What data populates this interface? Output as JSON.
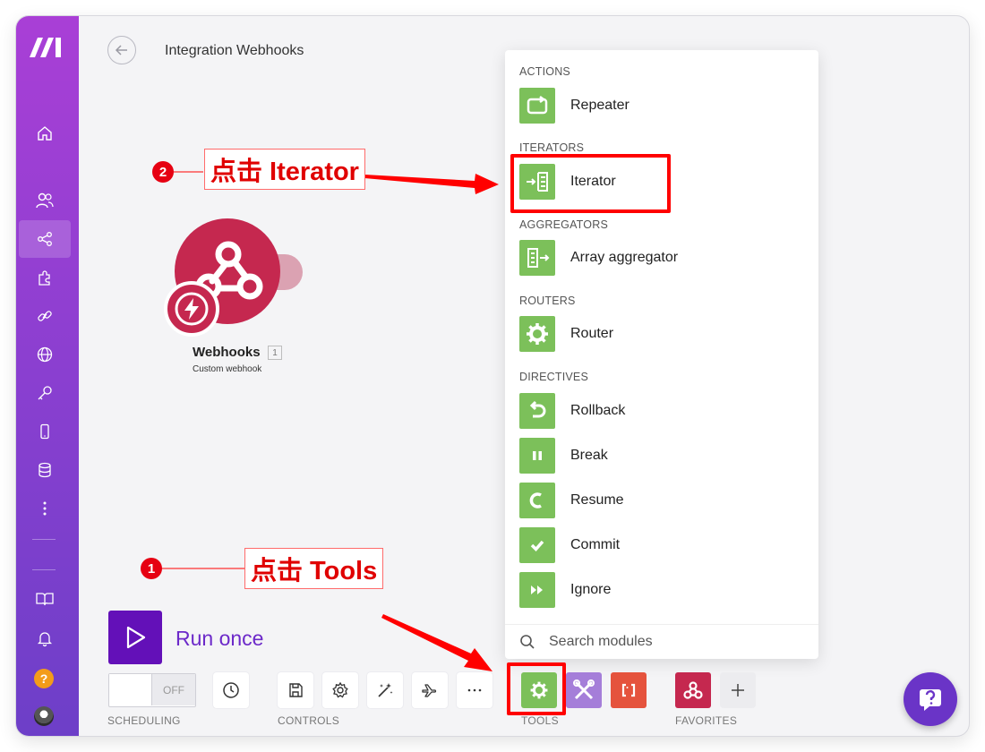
{
  "header": {
    "title": "Integration Webhooks"
  },
  "node": {
    "label": "Webhooks",
    "badge": "1",
    "subtitle": "Custom webhook",
    "color": "#c5284f"
  },
  "menu": {
    "sections": {
      "actions": "ACTIONS",
      "iterators": "ITERATORS",
      "aggregators": "AGGREGATORS",
      "routers": "ROUTERS",
      "directives": "DIRECTIVES"
    },
    "items": {
      "repeater": "Repeater",
      "iterator": "Iterator",
      "array_aggregator": "Array aggregator",
      "router": "Router",
      "rollback": "Rollback",
      "break": "Break",
      "resume": "Resume",
      "commit": "Commit",
      "ignore": "Ignore"
    },
    "search_label": "Search modules",
    "icon_color": "#7cc05a"
  },
  "run": {
    "label": "Run once"
  },
  "toolbar": {
    "toggle_off": "OFF",
    "labels": {
      "scheduling": "SCHEDULING",
      "controls": "CONTROLS",
      "tools": "TOOLS",
      "favorites": "FAVORITES"
    }
  },
  "annotations": {
    "step1_number": "1",
    "step1_text": "点击 Tools",
    "step2_number": "2",
    "step2_text": "点击 Iterator",
    "color": "#ff0000"
  },
  "sidebar": {
    "help_label": "?"
  },
  "brand": {
    "accent": "#6310b8"
  }
}
